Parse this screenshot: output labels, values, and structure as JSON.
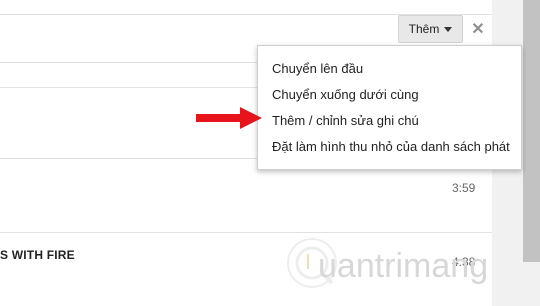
{
  "toolbar": {
    "more_label": "Thêm"
  },
  "menu": {
    "items": [
      "Chuyển lên đầu",
      "Chuyển xuống dưới cùng",
      "Thêm / chỉnh sửa ghi chú",
      "Đặt làm hình thu nhỏ của danh sách phát"
    ]
  },
  "tracks": [
    {
      "title": "",
      "duration": "3:59"
    },
    {
      "title": "S WITH FIRE",
      "duration": "4:38"
    }
  ],
  "watermark": {
    "text": "uantrimang"
  },
  "colors": {
    "arrow": "#e8141b",
    "button_bg": "#e8e8e8",
    "scrollbar_thumb": "#c2c2c2"
  }
}
